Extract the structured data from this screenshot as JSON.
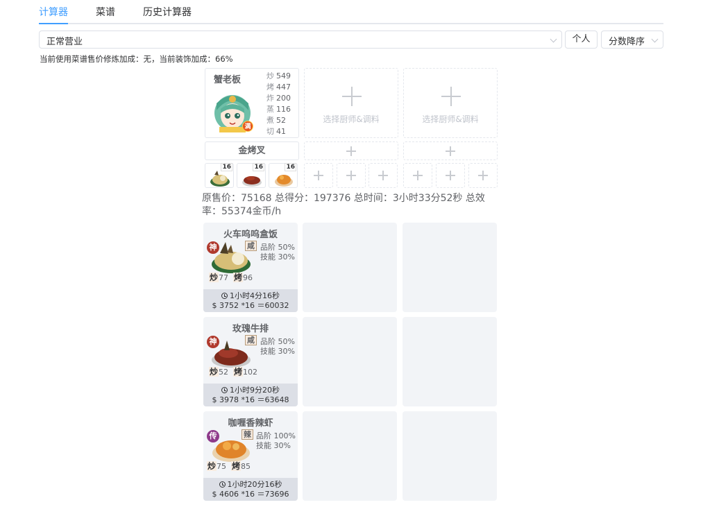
{
  "tabs": [
    {
      "label": "计算器",
      "active": true
    },
    {
      "label": "菜谱"
    },
    {
      "label": "历史计算器"
    }
  ],
  "toolbar": {
    "mode_value": "正常营业",
    "personal_label": "个人",
    "sort_value": "分数降序"
  },
  "info_line": "当前使用菜谱售价修炼加成：无，当前装饰加成：66%",
  "chef": {
    "name": "蟹老板",
    "badge": "满",
    "skills": [
      {
        "k": "炒",
        "v": "549"
      },
      {
        "k": "烤",
        "v": "447"
      },
      {
        "k": "炸",
        "v": "200"
      },
      {
        "k": "蒸",
        "v": "116"
      },
      {
        "k": "煮",
        "v": "52"
      },
      {
        "k": "切",
        "v": "41"
      }
    ]
  },
  "empty_chef_label": "选择厨师&调料",
  "equipment": "金烤叉",
  "recipe_slot_qty": [
    "16",
    "16",
    "16"
  ],
  "summary": {
    "line1": "原售价：75168 总得分：197376 总时间：3小时33分52秒 总效",
    "line2": "率：55374金币/h"
  },
  "dishes": [
    {
      "title": "火车呜呜盒饭",
      "rarity": "神",
      "rarity_color": "#b03a2e",
      "flavor": "咸",
      "rate1": "品阶 50%",
      "rate2": "技能 30%",
      "need1_k": "炒",
      "need1_v": "77",
      "need2_k": "烤",
      "need2_v": "96",
      "time": "1小时4分16秒",
      "calc": "$ 3752 *16 ＝60032"
    },
    {
      "title": "玫瑰牛排",
      "rarity": "神",
      "rarity_color": "#b03a2e",
      "flavor": "咸",
      "rate1": "品阶 50%",
      "rate2": "技能 30%",
      "need1_k": "炒",
      "need1_v": "52",
      "need2_k": "烤",
      "need2_v": "102",
      "time": "1小时9分20秒",
      "calc": "$ 3978 *16 ＝63648"
    },
    {
      "title": "咖喱香辣虾",
      "rarity": "传",
      "rarity_color": "#8e3a8a",
      "flavor": "辣",
      "rate1": "品阶 100%",
      "rate2": "技能 30%",
      "need1_k": "炒",
      "need1_v": "75",
      "need2_k": "烤",
      "need2_v": "85",
      "time": "1小时20分16秒",
      "calc": "$ 4606 *16 ＝73696"
    }
  ]
}
